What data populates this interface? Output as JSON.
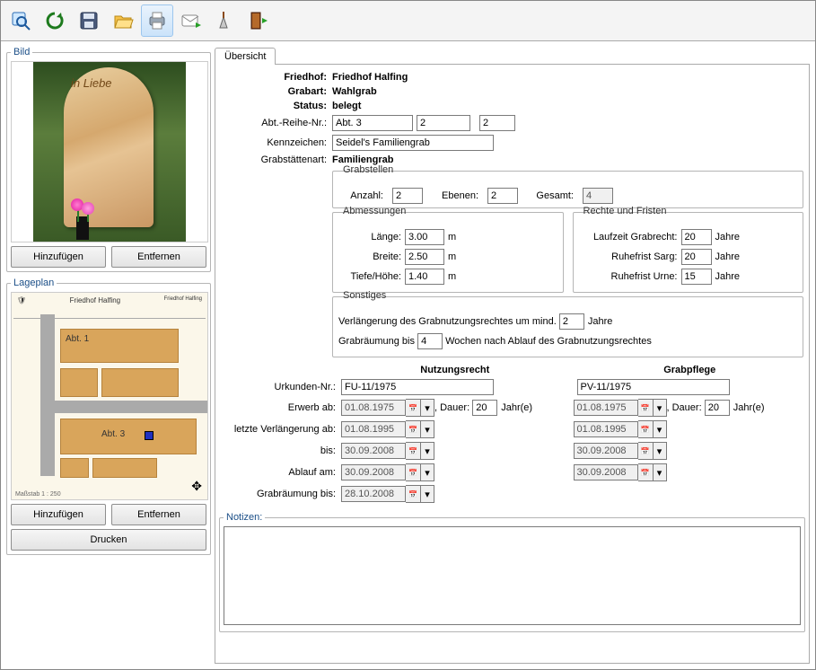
{
  "toolbar_icons": [
    "magnify",
    "refresh",
    "save",
    "open",
    "print",
    "mail",
    "trowel",
    "exit"
  ],
  "left": {
    "image_panel": "Bild",
    "stone_inscription": "in Liebe",
    "add": "Hinzufügen",
    "remove": "Entfernen",
    "plan_panel": "Lageplan",
    "print": "Drucken",
    "map_title_center": "Friedhof Halfing",
    "map_abt1": "Abt. 1",
    "map_abt3": "Abt. 3",
    "map_legend": "Maßstab 1 : 250"
  },
  "tab": "Übersicht",
  "labels": {
    "friedhof": "Friedhof:",
    "grabart": "Grabart:",
    "status": "Status:",
    "abt": "Abt.-Reihe-Nr.:",
    "kennz": "Kennzeichen:",
    "grabart2": "Grabstättenart:",
    "grabstellen": "Grabstellen",
    "anzahl": "Anzahl:",
    "ebenen": "Ebenen:",
    "gesamt": "Gesamt:",
    "abm": "Abmessungen",
    "laenge": "Länge:",
    "breite": "Breite:",
    "tiefe": "Tiefe/Höhe:",
    "m": "m",
    "rechte": "Rechte und Fristen",
    "laufzeit": "Laufzeit Grabrecht:",
    "ruhesarg": "Ruhefrist Sarg:",
    "ruheurne": "Ruhefrist Urne:",
    "jahre": "Jahre",
    "sonst": "Sonstiges",
    "verl": "Verlängerung des Grabnutzungsrechtes um mind.",
    "grabr": "Grabräumung bis",
    "grabr2": "Wochen nach Ablauf des Grabnutzungsrechtes",
    "nutzung": "Nutzungsrecht",
    "pflege": "Grabpflege",
    "urkunde": "Urkunden-Nr.:",
    "erwerb": "Erwerb ab:",
    "dauer": ", Dauer:",
    "jahr_e": "Jahr(e)",
    "letzteverl": "letzte Verlängerung ab:",
    "bis": "bis:",
    "ablauf": "Ablauf am:",
    "raeumbis": "Grabräumung bis:",
    "notizen": "Notizen:"
  },
  "values": {
    "friedhof": "Friedhof Halfing",
    "grabart": "Wahlgrab",
    "status": "belegt",
    "abt1": "Abt. 3",
    "abt2": "2",
    "abt3": "2",
    "kennz": "Seidel's Familiengrab",
    "grabstart": "Familiengrab",
    "anzahl": "2",
    "ebenen": "2",
    "gesamt": "4",
    "laenge": "3.00",
    "breite": "2.50",
    "tiefe": "1.40",
    "laufzeit": "20",
    "ruhesarg": "20",
    "ruheurne": "15",
    "verl_jahre": "2",
    "grabr_wochen": "4",
    "n_urkunde": "FU-11/1975",
    "p_urkunde": "PV-11/1975",
    "n_erwerb": "01.08.1975",
    "p_erwerb": "01.08.1975",
    "n_dauer": "20",
    "p_dauer": "20",
    "n_verl": "01.08.1995",
    "p_verl": "01.08.1995",
    "n_bis": "30.09.2008",
    "p_bis": "30.09.2008",
    "n_ablauf": "30.09.2008",
    "p_ablauf": "30.09.2008",
    "n_raeum": "28.10.2008",
    "notizen": ""
  }
}
